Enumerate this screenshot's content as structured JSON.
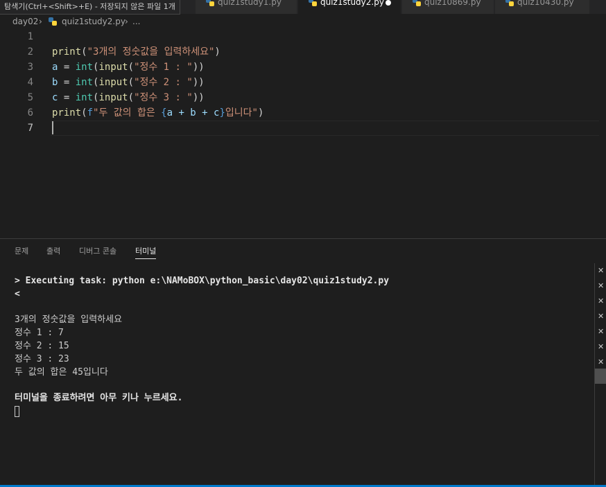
{
  "tooltip": "탐색기(Ctrl+<Shift>+E) - 저장되지 않은 파일 1개",
  "tabs": [
    {
      "label": "quiz1study1.py"
    },
    {
      "label": "quiz1study2.py"
    },
    {
      "label": "quiz10869.py"
    },
    {
      "label": "quiz10430.py"
    }
  ],
  "breadcrumb": {
    "folder": "day02",
    "file": "quiz1study2.py",
    "more": "..."
  },
  "editor": {
    "line_numbers": [
      "1",
      "2",
      "3",
      "4",
      "5",
      "6",
      "7"
    ],
    "line2": {
      "fn": "print",
      "p1": "(",
      "str": "\"3개의 정숫값을 입력하세요\"",
      "p2": ")"
    },
    "line3": {
      "var": "a",
      "eq": " = ",
      "type": "int",
      "p1": "(",
      "fn": "input",
      "p2": "(",
      "str": "\"정수 1 : \"",
      "p3": "))"
    },
    "line4": {
      "var": "b",
      "eq": " = ",
      "type": "int",
      "p1": "(",
      "fn": "input",
      "p2": "(",
      "str": "\"정수 2 : \"",
      "p3": "))"
    },
    "line5": {
      "var": "c",
      "eq": " = ",
      "type": "int",
      "p1": "(",
      "fn": "input",
      "p2": "(",
      "str": "\"정수 3 : \"",
      "p3": "))"
    },
    "line6": {
      "fn": "print",
      "p1": "(",
      "fprefix": "f",
      "str1": "\"두 값의 합은 ",
      "brace_open": "{",
      "expr": "a + b + c",
      "brace_close": "}",
      "str2": "입니다\"",
      "p2": ")"
    }
  },
  "panel_tabs": [
    "문제",
    "출력",
    "디버그 콘솔",
    "터미널"
  ],
  "terminal": {
    "task_line": "> Executing task: python e:\\NAMoBOX\\python_basic\\day02\\quiz1study2.py",
    "prompt_char": "<",
    "output": [
      "3개의 정숫값을 입력하세요",
      "정수 1 : 7",
      "정수 2 : 15",
      "정수 3 : 23",
      "두 값의 합은 45입니다"
    ],
    "exit_message": "터미널을 종료하려면 아무 키나 누르세요."
  },
  "side_marks": [
    "✕",
    "✕",
    "✕",
    "✕",
    "✕",
    "✕",
    "✕",
    "✕"
  ],
  "colors": {
    "accent": "#007acc",
    "python_blue": "#3572a5",
    "python_yellow": "#ffd43b",
    "string": "#ce9178",
    "function": "#dcdcaa",
    "variable": "#9cdcfe"
  }
}
